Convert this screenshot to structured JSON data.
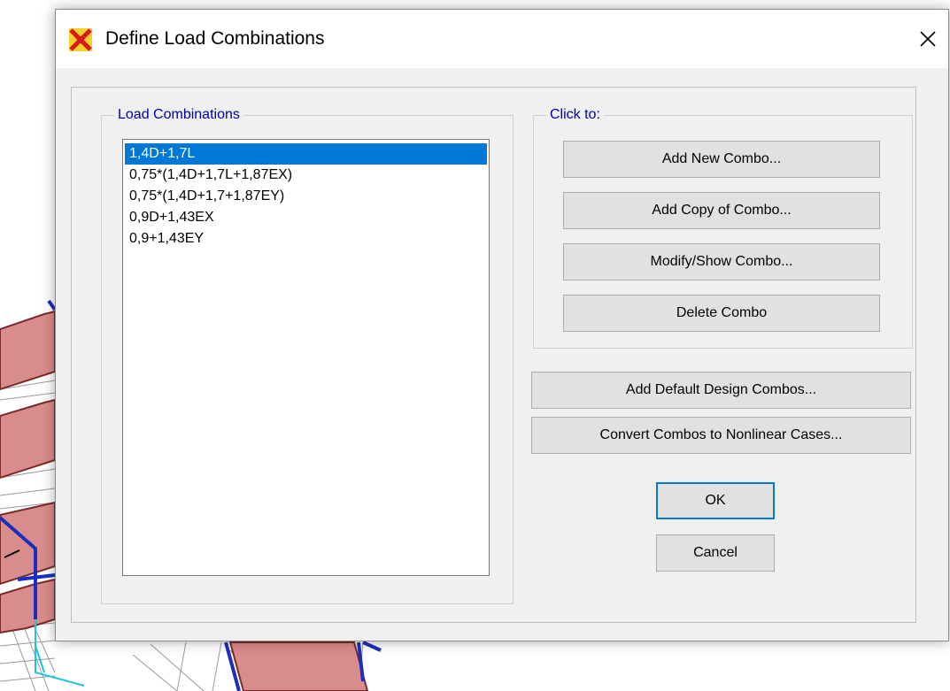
{
  "dialog": {
    "title": "Define Load Combinations",
    "close_glyph": "✕"
  },
  "load_combinations": {
    "label": "Load Combinations",
    "items": [
      "1,4D+1,7L",
      "0,75*(1,4D+1,7L+1,87EX)",
      "0,75*(1,4D+1,7+1,87EY)",
      "0,9D+1,43EX",
      "0,9+1,43EY"
    ],
    "selected_index": 0
  },
  "click_to": {
    "label": "Click to:",
    "add_new": "Add New Combo...",
    "add_copy": "Add Copy of Combo...",
    "modify_show": "Modify/Show Combo...",
    "delete": "Delete Combo"
  },
  "extra_buttons": {
    "add_default": "Add Default Design Combos...",
    "convert": "Convert Combos to Nonlinear Cases..."
  },
  "footer": {
    "ok": "OK",
    "cancel": "Cancel"
  },
  "colors": {
    "group_label": "#0000a8",
    "selection": "#0078d7",
    "default_button_border": "#0078d7",
    "model_fill": "#d98c8c",
    "model_frame": "#1a2fbf"
  },
  "icons": {
    "app": "etabs-app-icon",
    "close": "close-icon"
  }
}
